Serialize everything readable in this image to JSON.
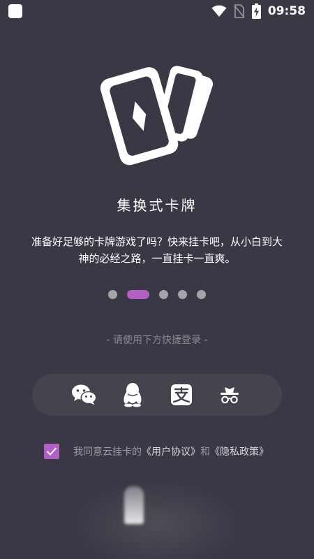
{
  "status_bar": {
    "time": "09:58",
    "icons": [
      "app-square-icon",
      "wifi-icon",
      "no-sim-icon",
      "battery-charging-icon"
    ]
  },
  "hero": {
    "icon": "playing-cards-icon"
  },
  "title": "集换式卡牌",
  "description": "准备好足够的卡牌游戏了吗？快来挂卡吧，从小白到大神的必经之路，一直挂卡一直爽。",
  "pager": {
    "count": 5,
    "active_index": 1
  },
  "login_hint": "- 请使用下方快捷登录 -",
  "social_logins": [
    "wechat-icon",
    "qq-icon",
    "alipay-icon",
    "incognito-icon"
  ],
  "agreement": {
    "checked": true,
    "prefix": "我同意云挂卡的",
    "user_agreement": "《用户协议》",
    "conjunction": "和",
    "privacy_policy": "《隐私政策》"
  },
  "colors": {
    "background": "#3b3845",
    "accent": "#b45fc4",
    "panel": "#46434f",
    "dot_inactive": "#a4a3a8"
  }
}
